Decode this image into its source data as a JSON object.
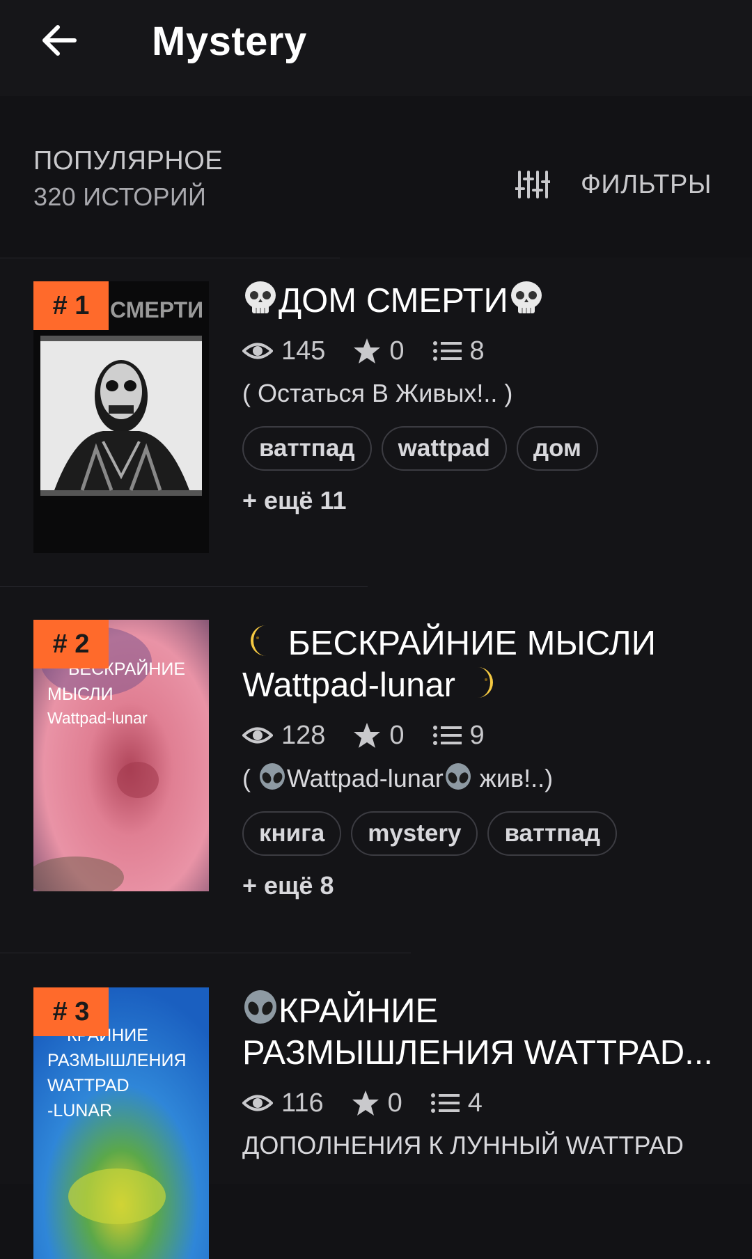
{
  "header": {
    "title": "Mystery",
    "back_icon": "arrow-left-icon"
  },
  "subheader": {
    "sort_label": "ПОПУЛЯРНОЕ",
    "count_label": "320 ИСТОРИЙ",
    "filters_label": "ФИЛЬТРЫ",
    "filters_icon": "sliders-icon"
  },
  "colors": {
    "background": "#121215",
    "header_bg": "#161619",
    "rank_badge": "#ff6a2b",
    "text_primary": "#ffffff",
    "text_secondary": "#c9c9cc"
  },
  "stories": [
    {
      "rank": "# 1",
      "cover_text": "СМЕРТИ",
      "title": "ДОМ СМЕРТИ",
      "title_emoji": "skull-emoji",
      "views": "145",
      "votes": "0",
      "parts": "8",
      "description": "(   Остаться В Живых!.. )",
      "tags": [
        "ваттпад",
        "wattpad",
        "дом"
      ],
      "more_tags": "+ ещё 11"
    },
    {
      "rank": "# 2",
      "cover_text_line1": "БЕСКРАЙНИЕ",
      "cover_text_line2": "МЫСЛИ",
      "cover_text_line3": "Wattpad-lunar",
      "title_line1": "БЕСКРАЙНИЕ МЫСЛИ",
      "title_line2": "Wattpad-lunar",
      "title_emoji": "moon-emoji",
      "views": "128",
      "votes": "0",
      "parts": "9",
      "description_part1": "( ",
      "description_part2": "Wattpad-lunar",
      "description_part3": " жив!..)",
      "description_emoji": "alien-emoji",
      "tags": [
        "книга",
        "mystery",
        "ваттпад"
      ],
      "more_tags": "+ ещё 8"
    },
    {
      "rank": "# 3",
      "cover_text_line1": "КРАЙНИЕ",
      "cover_text_line2": "РАЗМЫШЛЕНИЯ",
      "cover_text_line3": "WATTPAD",
      "cover_text_line4": "-LUNAR",
      "title_line1": "КРАЙНИЕ",
      "title_line2": "РАЗМЫШЛЕНИЯ WATTPAD...",
      "title_emoji": "alien-emoji",
      "views": "116",
      "votes": "0",
      "parts": "4",
      "description": "ДОПОЛНЕНИЯ К ЛУННЫЙ WATTPAD"
    }
  ]
}
